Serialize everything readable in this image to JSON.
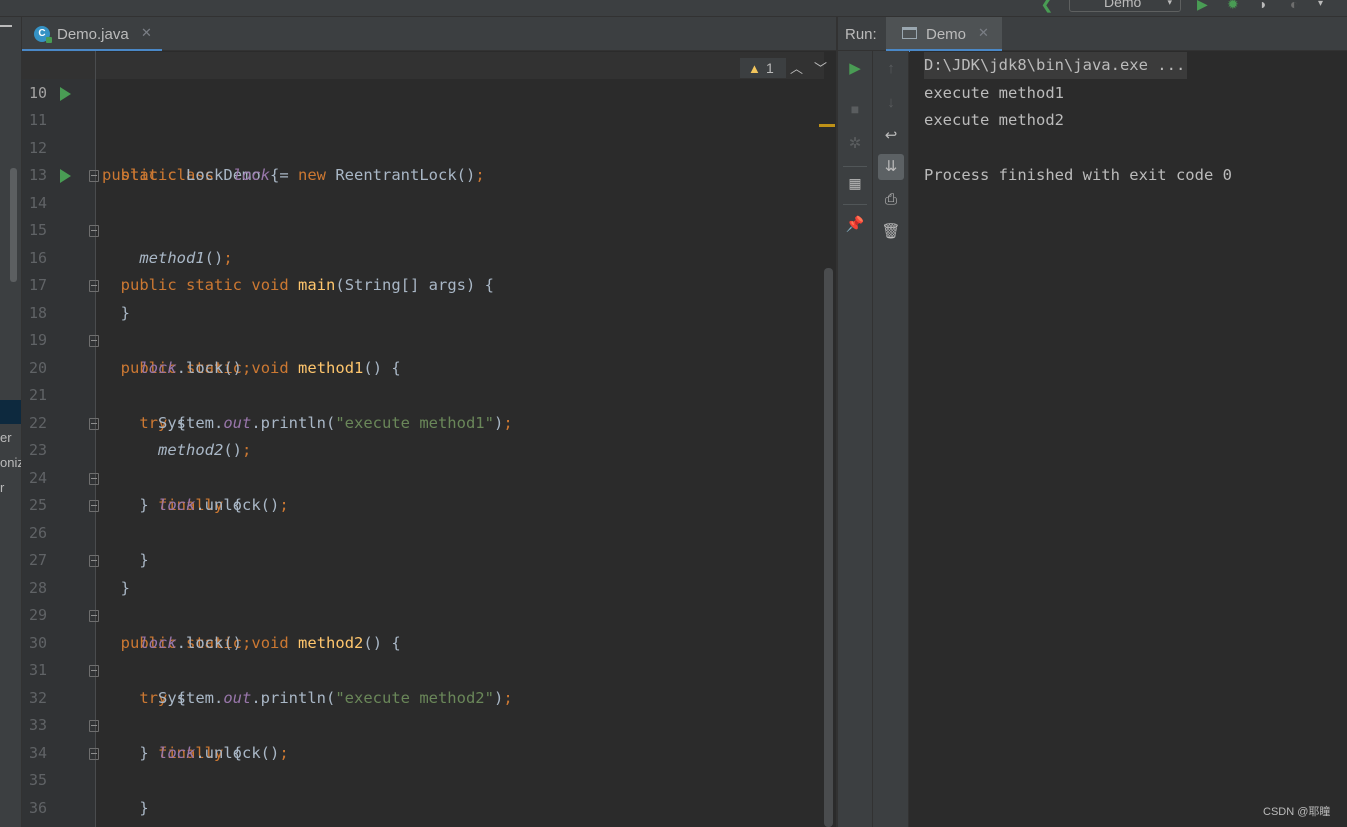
{
  "toolbar": {
    "run_config_label": "Demo",
    "run_config_caret": "▾"
  },
  "project_panel": {
    "fragments": [
      "er",
      "oniz",
      "r"
    ]
  },
  "editor": {
    "tab": {
      "label": "Demo.java",
      "close": "✕",
      "icon": "class-icon"
    },
    "inspections": {
      "warning_icon": "▲",
      "warning_count": "1",
      "prev": "︿",
      "next": "﹀"
    },
    "current_line": "10",
    "lines": [
      {
        "n": "10"
      },
      {
        "n": "11",
        "run": true
      },
      {
        "n": "12"
      },
      {
        "n": "13"
      },
      {
        "n": "14",
        "run": true,
        "fold": true
      },
      {
        "n": "15"
      },
      {
        "n": "16",
        "fold": true
      },
      {
        "n": "17"
      },
      {
        "n": "18",
        "fold": true
      },
      {
        "n": "19"
      },
      {
        "n": "20",
        "fold": true
      },
      {
        "n": "21"
      },
      {
        "n": "22"
      },
      {
        "n": "23",
        "fold": true
      },
      {
        "n": "24"
      },
      {
        "n": "25",
        "fold": true
      },
      {
        "n": "26",
        "fold": true
      },
      {
        "n": "27"
      },
      {
        "n": "28",
        "fold": true
      },
      {
        "n": "29"
      },
      {
        "n": "30",
        "fold": true
      },
      {
        "n": "31"
      },
      {
        "n": "32",
        "fold": true
      },
      {
        "n": "33"
      },
      {
        "n": "34",
        "fold": true
      },
      {
        "n": "35",
        "fold": true
      },
      {
        "n": "36"
      }
    ],
    "code": {
      "l11": {
        "kw1": "public",
        "kw2": "class",
        "name": "Demo",
        "brace": " {"
      },
      "l12": {
        "kw1": "static",
        "type": "Lock",
        "field": "lock",
        "eq": " = ",
        "kw2": "new",
        "ctor": " ReentrantLock()",
        "semi": ";"
      },
      "l14": {
        "kw1": "public",
        "kw2": "static",
        "kw3": "void",
        "fn": "main",
        "params": "(String[] args) {"
      },
      "l15": {
        "call": "method1",
        "paren": "()",
        "semi": ";"
      },
      "l16": {
        "text": "}"
      },
      "l18": {
        "kw1": "public",
        "kw2": "static",
        "kw3": "void",
        "fn": "method1",
        "params": "() {"
      },
      "l19": {
        "field": "lock",
        "call": ".lock()",
        "semi": ";"
      },
      "l20": {
        "kw": "try",
        "brace": " {"
      },
      "l21": {
        "cls": "System.",
        "sfield": "out",
        "call": ".println(",
        "str": "\"execute method1\"",
        "close": ")",
        "semi": ";"
      },
      "l22": {
        "call": "method2",
        "paren": "()",
        "semi": ";"
      },
      "l23": {
        "pre": "} ",
        "kw": "finally",
        "brace": " {"
      },
      "l24": {
        "field": "lock",
        "call": ".unlock()",
        "semi": ";"
      },
      "l25": {
        "text": "}"
      },
      "l26": {
        "text": "}"
      },
      "l28": {
        "kw1": "public",
        "kw2": "static",
        "kw3": "void",
        "fn": "method2",
        "params": "() {"
      },
      "l29": {
        "field": "lock",
        "call": ".lock()",
        "semi": ";"
      },
      "l30": {
        "kw": "try",
        "brace": " {"
      },
      "l31": {
        "cls": "System.",
        "sfield": "out",
        "call": ".println(",
        "str": "\"execute method2\"",
        "close": ")",
        "semi": ";"
      },
      "l32": {
        "pre": "} ",
        "kw": "finally",
        "brace": " {"
      },
      "l33": {
        "field": "lock",
        "call": ".unlock()",
        "semi": ";"
      },
      "l34": {
        "text": "}"
      },
      "l35": {
        "text": "}"
      },
      "l36": {
        "text": "}"
      }
    }
  },
  "run_panel": {
    "label": "Run:",
    "tab": {
      "label": "Demo",
      "close": "✕"
    },
    "console": [
      "D:\\JDK\\jdk8\\bin\\java.exe ...",
      "execute method1",
      "execute method2",
      "",
      "Process finished with exit code 0"
    ]
  },
  "watermark": "CSDN @耶瞳",
  "colors": {
    "keyword": "#cc7832",
    "function": "#ffc66d",
    "field": "#9876aa",
    "string": "#6a8759",
    "run_green": "#499c54",
    "accent_blue": "#4a88c7"
  }
}
